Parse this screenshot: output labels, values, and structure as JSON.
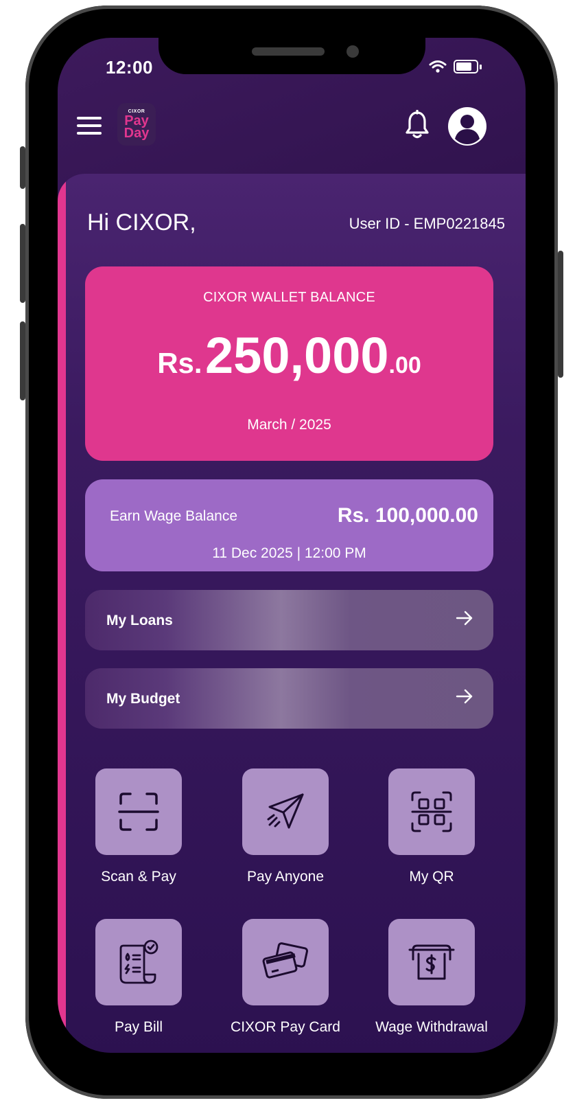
{
  "status_bar": {
    "time": "12:00"
  },
  "header": {
    "logo": {
      "brand_small": "CIXOR",
      "line1": "Pay",
      "line2": "Day"
    }
  },
  "greeting": "Hi CIXOR,",
  "user_id": "User ID - EMP0221845",
  "wallet": {
    "title": "CIXOR WALLET BALANCE",
    "currency": "Rs.",
    "amount_main": "250,000",
    "amount_cents": ".00",
    "period": "March / 2025"
  },
  "earn_wage": {
    "label": "Earn Wage Balance",
    "amount": "Rs. 100,000.00",
    "date": "11 Dec 2025 | 12:00 PM"
  },
  "links": [
    {
      "label": "My Loans",
      "icon": "arrow-right-icon"
    },
    {
      "label": "My Budget",
      "icon": "arrow-right-icon"
    }
  ],
  "actions": [
    {
      "label": "Scan & Pay",
      "icon": "scan-icon"
    },
    {
      "label": "Pay Anyone",
      "icon": "paper-plane-icon"
    },
    {
      "label": "My QR",
      "icon": "qr-code-icon"
    },
    {
      "label": "Pay Bill",
      "icon": "bill-icon"
    },
    {
      "label": "CIXOR Pay Card",
      "icon": "cards-icon"
    },
    {
      "label": "Wage Withdrawal",
      "icon": "cash-withdrawal-icon"
    }
  ],
  "colors": {
    "accent_pink": "#df378e",
    "wage_purple": "#9d6ac6",
    "tile_lilac": "#ad91c6",
    "background": "#2a0f47"
  }
}
